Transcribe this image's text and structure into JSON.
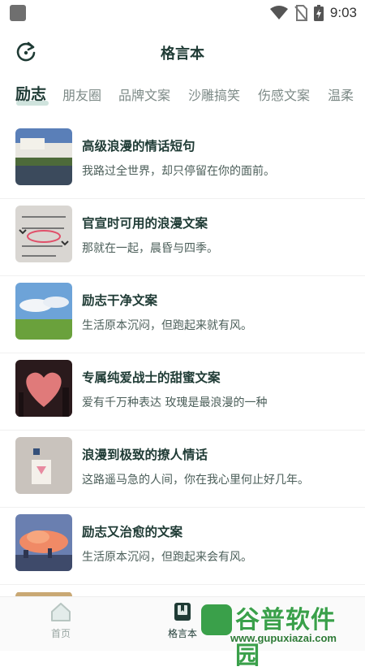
{
  "status": {
    "time": "9:03"
  },
  "header": {
    "title": "格言本"
  },
  "tabs": [
    "励志",
    "朋友圈",
    "品牌文案",
    "沙雕搞笑",
    "伤感文案",
    "温柔"
  ],
  "items": [
    {
      "title": "高级浪漫的情话短句",
      "subtitle": "我路过全世界，却只停留在你的面前。"
    },
    {
      "title": "官宣时可用的浪漫文案",
      "subtitle": "那就在一起，晨昏与四季。"
    },
    {
      "title": "励志干净文案",
      "subtitle": "生活原本沉闷，但跑起来就有风。"
    },
    {
      "title": "专属纯爱战士的甜蜜文案",
      "subtitle": "爱有千万种表达 玫瑰是最浪漫的一种"
    },
    {
      "title": "浪漫到极致的撩人情话",
      "subtitle": "这路遥马急的人间，你在我心里何止好几年。"
    },
    {
      "title": "励志又治愈的文案",
      "subtitle": "生活原本沉闷，但跑起来会有风。"
    }
  ],
  "nav": {
    "home": "首页",
    "book": "格言本"
  },
  "watermark": {
    "name": "谷普软件园",
    "url": "www.gupuxiazai.com"
  }
}
